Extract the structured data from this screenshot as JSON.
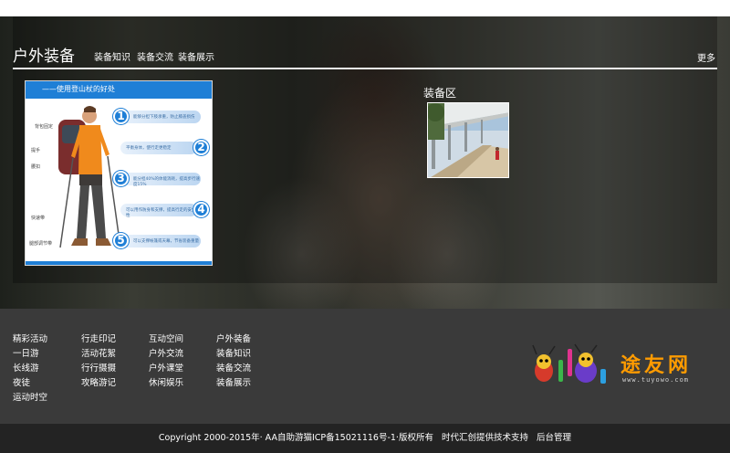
{
  "section": {
    "title": "户外装备",
    "tabs": [
      "装备知识",
      "装备交流",
      "装备展示"
    ],
    "more_label": "更多"
  },
  "infographic": {
    "title": "——使用登山杖的好处",
    "tags": [
      "背包固定",
      "提手",
      "腰扣",
      "快速带",
      "腿部调节带"
    ],
    "steps": [
      {
        "num": "1",
        "text": "能够分担下肢承重，防止膝盖损伤"
      },
      {
        "num": "2",
        "text": "平衡身体，使行走更稳定"
      },
      {
        "num": "3",
        "text": "能分担40%的体能消耗，提高步行速度15%"
      },
      {
        "num": "4",
        "text": "可以用作防身和支撑，提高行走的安全性"
      },
      {
        "num": "5",
        "text": "可以支撑帐篷或天幕，节省装备重量"
      }
    ]
  },
  "equipment_zone": {
    "title": "装备区"
  },
  "footer": {
    "columns": [
      [
        "精彩活动",
        "一日游",
        "长线游",
        "夜徒",
        "运动时空"
      ],
      [
        "行走印记",
        "活动花絮",
        "行行摄摄",
        "攻略游记"
      ],
      [
        "互动空间",
        "户外交流",
        "户外课堂",
        "休闲娱乐"
      ],
      [
        "户外装备",
        "装备知识",
        "装备交流",
        "装备展示"
      ]
    ],
    "logo_text": "途友网",
    "logo_url": "www.tuyowo.com"
  },
  "copyright": {
    "text": "Copyright 2000-2015年· AA自助游猫ICP备15021116号-1·版权所有",
    "tech": "时代汇创提供技术支持",
    "admin": "后台管理"
  },
  "colors": {
    "accent_blue": "#1f7fd6",
    "logo_orange": "#ff9b00",
    "footer_bg": "#3a3a3a",
    "copyright_bg": "#232323"
  }
}
